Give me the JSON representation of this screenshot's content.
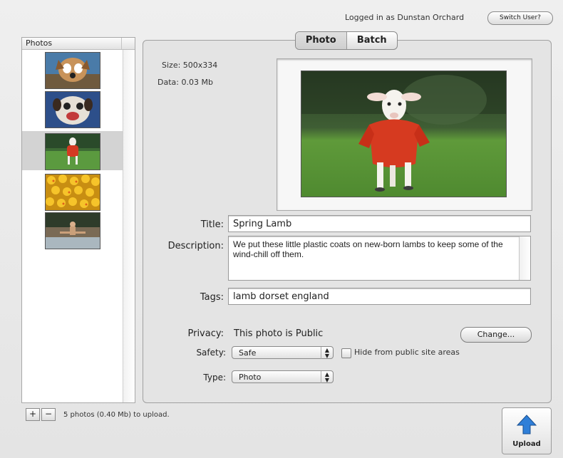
{
  "header": {
    "logged_in_text": "Logged in as Dunstan Orchard",
    "switch_user_label": "Switch User?"
  },
  "photos_panel": {
    "title": "Photos",
    "items": [
      {
        "name": "dog-photo"
      },
      {
        "name": "puppy-photo"
      },
      {
        "name": "lamb-photo",
        "selected": true
      },
      {
        "name": "ducks-photo"
      },
      {
        "name": "river-photo"
      }
    ]
  },
  "tabs": {
    "photo": "Photo",
    "batch": "Batch",
    "active": "photo"
  },
  "photo_info": {
    "size": "Size: 500x334",
    "data": "Data: 0.03 Mb"
  },
  "form": {
    "title_label": "Title:",
    "title_value": "Spring Lamb",
    "description_label": "Description:",
    "description_value": "We put these little plastic coats on new-born lambs to keep some of the wind-chill off them.",
    "tags_label": "Tags:",
    "tags_value": "lamb dorset england",
    "privacy_label": "Privacy:",
    "privacy_value": "This photo is Public",
    "change_label": "Change...",
    "safety_label": "Safety:",
    "safety_value": "Safe",
    "hide_label": "Hide from public site areas",
    "type_label": "Type:",
    "type_value": "Photo"
  },
  "footer": {
    "add_label": "+",
    "remove_label": "−",
    "status": "5 photos (0.40 Mb) to upload.",
    "upload_label": "Upload"
  },
  "colors": {
    "upload_arrow": "#2f7fd8",
    "selection": "#d3d3d3"
  }
}
